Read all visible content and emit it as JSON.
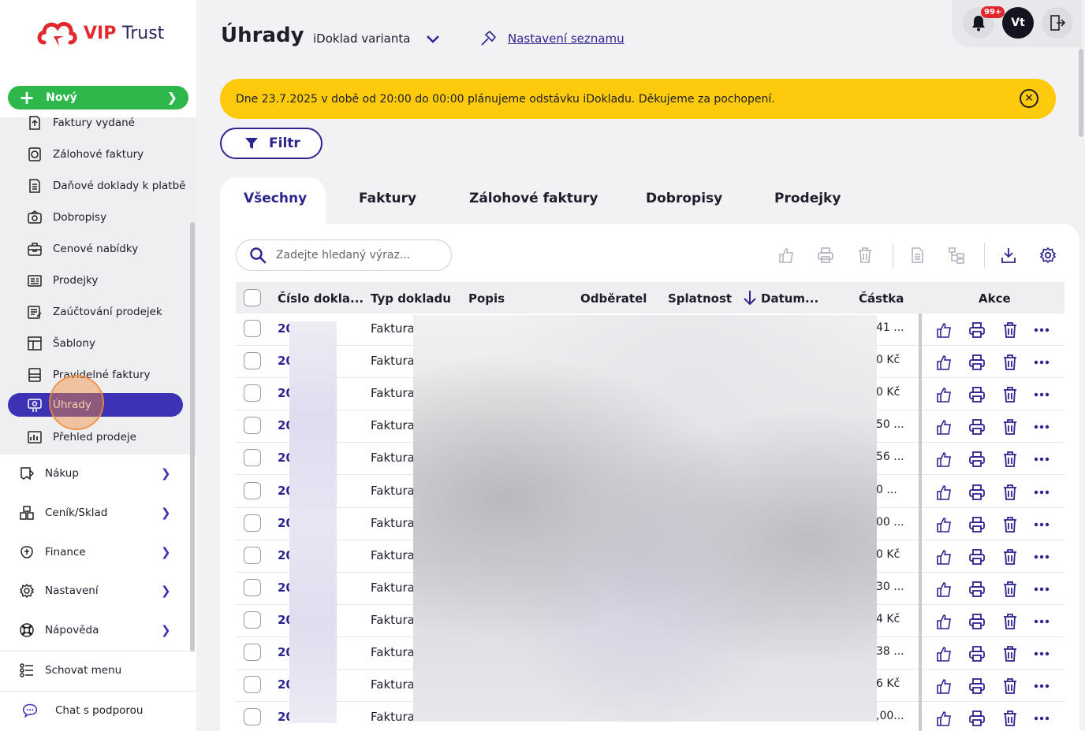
{
  "app": {
    "logo_text_1": "VIP",
    "logo_text_2": "Trust"
  },
  "sidebar": {
    "new_label": "Nový",
    "sub_items": [
      {
        "label": "Faktury vydané",
        "icon": "invoice-out-icon"
      },
      {
        "label": "Zálohové faktury",
        "icon": "advance-invoice-icon"
      },
      {
        "label": "Daňové doklady k platbě",
        "icon": "tax-document-icon"
      },
      {
        "label": "Dobropisy",
        "icon": "credit-note-icon"
      },
      {
        "label": "Cenové nabídky",
        "icon": "price-offer-icon"
      },
      {
        "label": "Prodejky",
        "icon": "receipt-icon"
      },
      {
        "label": "Zaúčtování prodejek",
        "icon": "receipt-accounting-icon"
      },
      {
        "label": "Šablony",
        "icon": "template-icon"
      },
      {
        "label": "Pravidelné faktury",
        "icon": "recurring-invoice-icon"
      },
      {
        "label": "Úhrady",
        "icon": "payments-icon",
        "active": true
      },
      {
        "label": "Přehled prodeje",
        "icon": "sales-overview-icon"
      }
    ],
    "main_items": [
      {
        "label": "Nákup",
        "icon": "purchase-icon"
      },
      {
        "label": "Ceník/Sklad",
        "icon": "warehouse-icon"
      },
      {
        "label": "Finance",
        "icon": "finance-icon"
      },
      {
        "label": "Nastavení",
        "icon": "gear-icon"
      },
      {
        "label": "Nápověda",
        "icon": "help-icon"
      }
    ],
    "hide_menu": "Schovat menu",
    "chat": "Chat s podporou"
  },
  "header": {
    "title": "Úhrady",
    "variant": "iDoklad varianta",
    "settings_link": "Nastavení seznamu",
    "notification_badge": "99+",
    "avatar_initials": "Vt"
  },
  "banner": {
    "text": "Dne 23.7.2025 v době od 20:00 do 00:00 plánujeme odstávku iDokladu. Děkujeme za pochopení."
  },
  "filter_label": "Filtr",
  "tabs": [
    "Všechny",
    "Faktury",
    "Zálohové faktury",
    "Dobropisy",
    "Prodejky"
  ],
  "search": {
    "placeholder": "Zadejte hledaný výraz..."
  },
  "table": {
    "columns": [
      "Číslo dokla...",
      "Typ dokladu",
      "Popis",
      "Odběratel",
      "Splatnost",
      "Datum...",
      "Částka",
      "Akce"
    ],
    "rows": [
      {
        "num": "20",
        "type": "Faktura",
        "amount": "41 ..."
      },
      {
        "num": "20",
        "type": "Faktura",
        "amount": "0 Kč"
      },
      {
        "num": "20",
        "type": "Faktura",
        "amount": "0 Kč"
      },
      {
        "num": "20",
        "type": "Faktura",
        "amount": "50 ..."
      },
      {
        "num": "20",
        "type": "Faktura",
        "amount": "56 ..."
      },
      {
        "num": "20",
        "type": "Faktura",
        "amount": "0 ..."
      },
      {
        "num": "20",
        "type": "Faktura",
        "amount": "00 ..."
      },
      {
        "num": "20",
        "type": "Faktura",
        "amount": "0 Kč"
      },
      {
        "num": "20",
        "type": "Faktura",
        "amount": "30 ..."
      },
      {
        "num": "20",
        "type": "Faktura",
        "amount": "4 Kč"
      },
      {
        "num": "20",
        "type": "Faktura",
        "amount": "38 ..."
      },
      {
        "num": "20",
        "type": "Faktura",
        "amount": "6 Kč"
      },
      {
        "num": "20",
        "type": "Faktura",
        "amount": ",00..."
      }
    ]
  },
  "colors": {
    "accent": "#2c2490",
    "active_nav": "#3c32b4",
    "new_button": "#2eb84c",
    "banner": "#fdca0c",
    "brand_red": "#e0282d"
  }
}
